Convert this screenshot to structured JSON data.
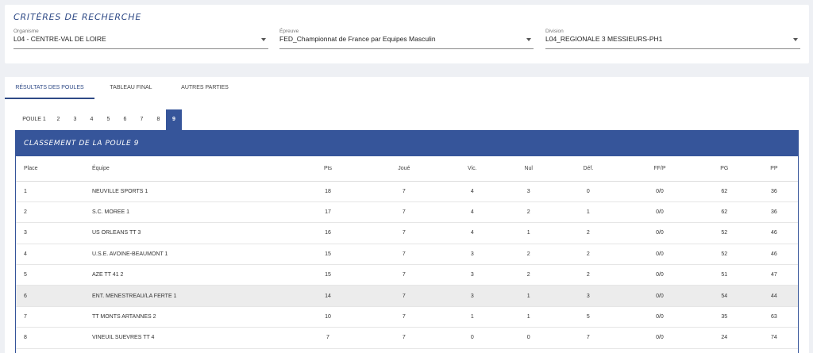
{
  "criteria": {
    "title": "Critères de recherche",
    "fields": [
      {
        "label": "Organisme",
        "value": "L04 - CENTRE-VAL DE LOIRE"
      },
      {
        "label": "Épreuve",
        "value": "FED_Championnat de France par Equipes Masculin"
      },
      {
        "label": "Division",
        "value": "L04_REGIONALE 3 MESSIEURS-PH1"
      }
    ]
  },
  "tabs": [
    "Résultats des poules",
    "Tableau final",
    "Autres parties"
  ],
  "poules": [
    "POULE 1",
    "2",
    "3",
    "4",
    "5",
    "6",
    "7",
    "8",
    "9"
  ],
  "table": {
    "title": "Classement de la poule 9",
    "headers": [
      "Place",
      "Équipe",
      "Pts",
      "Joué",
      "Vic.",
      "Nul",
      "Déf.",
      "FF/P",
      "PG",
      "PP"
    ],
    "rows": [
      [
        "1",
        "NEUVILLE SPORTS 1",
        "18",
        "7",
        "4",
        "3",
        "0",
        "0/0",
        "62",
        "36"
      ],
      [
        "2",
        "S.C. MOREE 1",
        "17",
        "7",
        "4",
        "2",
        "1",
        "0/0",
        "62",
        "36"
      ],
      [
        "3",
        "US ORLEANS TT 3",
        "16",
        "7",
        "4",
        "1",
        "2",
        "0/0",
        "52",
        "46"
      ],
      [
        "4",
        "U.S.E. AVOINE-BEAUMONT 1",
        "15",
        "7",
        "3",
        "2",
        "2",
        "0/0",
        "52",
        "46"
      ],
      [
        "5",
        "AZE TT 41 2",
        "15",
        "7",
        "3",
        "2",
        "2",
        "0/0",
        "51",
        "47"
      ],
      [
        "6",
        "ENT. MENESTREAU/LA FERTE 1",
        "14",
        "7",
        "3",
        "1",
        "3",
        "0/0",
        "54",
        "44"
      ],
      [
        "7",
        "TT MONTS ARTANNES 2",
        "10",
        "7",
        "1",
        "1",
        "5",
        "0/0",
        "35",
        "63"
      ],
      [
        "8",
        "VINEUIL SUEVRES TT 4",
        "7",
        "7",
        "0",
        "0",
        "7",
        "0/0",
        "24",
        "74"
      ]
    ]
  },
  "colors": {
    "accent": "#36559a",
    "title": "#2f4a86"
  }
}
